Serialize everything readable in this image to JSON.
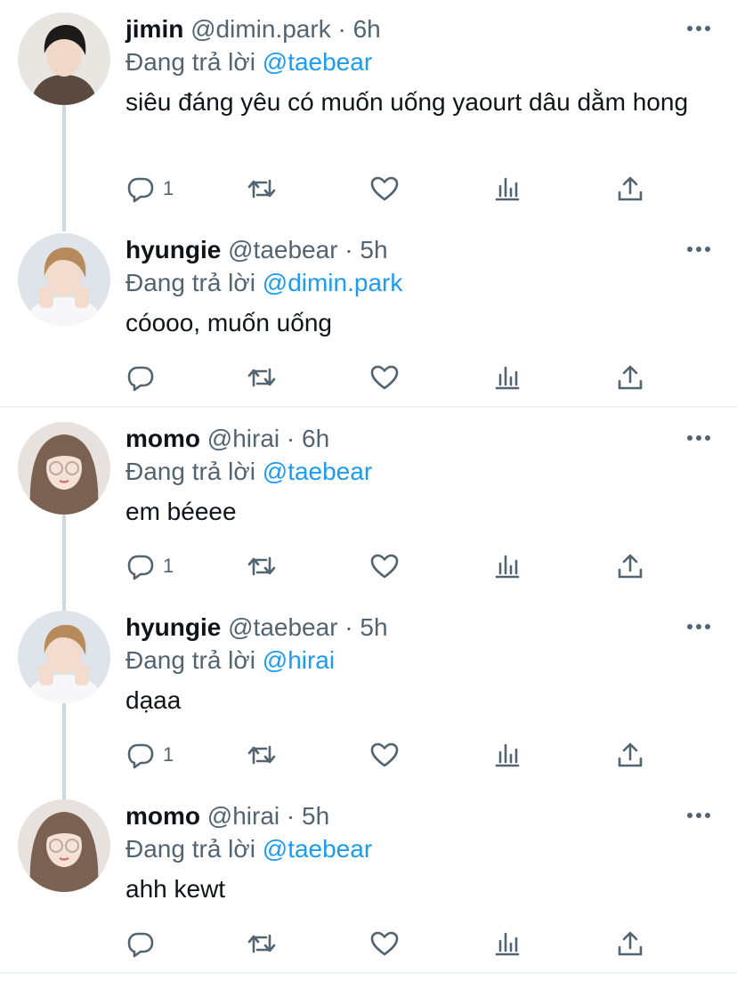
{
  "tweets": [
    {
      "name": "jimin",
      "handle": "@dimin.park",
      "sep": "·",
      "time": "6h",
      "reply_prefix": "Đang trả lời",
      "reply_to": "@taebear",
      "text": "siêu đáng yêu có muốn uống yaourt dâu dằm hong",
      "reply_count": "1"
    },
    {
      "name": "hyungie",
      "handle": "@taebear",
      "sep": "·",
      "time": "5h",
      "reply_prefix": "Đang trả lời",
      "reply_to": "@dimin.park",
      "text": "cóooo, muốn uống",
      "reply_count": ""
    },
    {
      "name": "momo",
      "handle": "@hirai",
      "sep": "·",
      "time": "6h",
      "reply_prefix": "Đang trả lời",
      "reply_to": "@taebear",
      "text": "em béeee",
      "reply_count": "1"
    },
    {
      "name": "hyungie",
      "handle": "@taebear",
      "sep": "·",
      "time": "5h",
      "reply_prefix": "Đang trả lời",
      "reply_to": "@hirai",
      "text": "dạaa",
      "reply_count": "1"
    },
    {
      "name": "momo",
      "handle": "@hirai",
      "sep": "·",
      "time": "5h",
      "reply_prefix": "Đang trả lời",
      "reply_to": "@taebear",
      "text": "ahh kewt",
      "reply_count": ""
    }
  ],
  "icons": {
    "reply": "reply-icon",
    "retweet": "retweet-icon",
    "like": "like-icon",
    "views": "views-icon",
    "share": "share-icon",
    "more": "more-icon"
  },
  "colors": {
    "text": "#0f1419",
    "secondary": "#536471",
    "mention": "#1d9bf0",
    "thread_line": "#cfd9de"
  }
}
